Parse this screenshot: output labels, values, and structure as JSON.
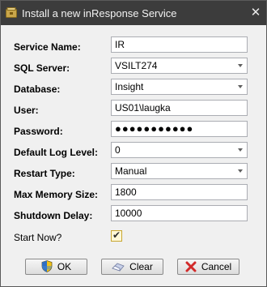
{
  "window": {
    "title": "Install a new inResponse Service",
    "close_glyph": "✕",
    "title_icon": "app-icon"
  },
  "form": {
    "service_name": {
      "label": "Service Name:",
      "value": "IR"
    },
    "sql_server": {
      "label": "SQL Server:",
      "value": "VSILT274"
    },
    "database": {
      "label": "Database:",
      "value": "Insight"
    },
    "user": {
      "label": "User:",
      "value": "US01\\laugka"
    },
    "password": {
      "label": "Password:",
      "value": "●●●●●●●●●●●"
    },
    "default_log_level": {
      "label": "Default Log Level:",
      "value": "0"
    },
    "restart_type": {
      "label": "Restart Type:",
      "value": "Manual"
    },
    "max_memory_size": {
      "label": "Max Memory Size:",
      "value": "1800"
    },
    "shutdown_delay": {
      "label": "Shutdown Delay:",
      "value": "10000"
    },
    "start_now": {
      "label": "Start Now?",
      "checked": true,
      "tick": "✔"
    }
  },
  "buttons": {
    "ok_label": "OK",
    "clear_label": "Clear",
    "cancel_label": "Cancel"
  },
  "colors": {
    "titlebar": "#3c3c3c",
    "dialog_bg": "#f0f0f0",
    "field_border": "#abadb3",
    "checkbox_border": "#c8a632",
    "cancel_red": "#d22a2a"
  }
}
